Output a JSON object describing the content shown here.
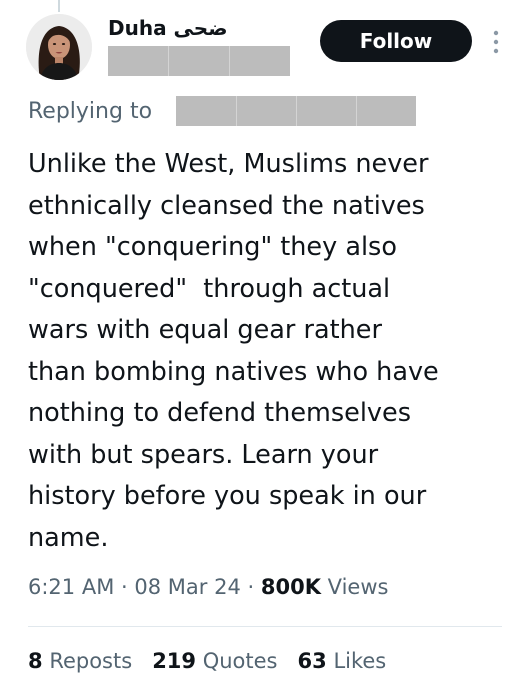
{
  "author": {
    "display_name": "Duha ضحى",
    "handle": "",
    "follow_label": "Follow"
  },
  "reply": {
    "label": "Replying to",
    "target": ""
  },
  "tweet": {
    "lines": [
      "Unlike the West, Muslims never",
      "ethnically cleansed the natives",
      "when \"conquering\" they also",
      "\"conquered\"  through actual",
      "wars with equal gear rather",
      "than bombing natives who have",
      "nothing to defend themselves",
      "with but spears. Learn your",
      "history before you speak in our",
      "name."
    ]
  },
  "meta": {
    "time": "6:21 AM",
    "separator": "·",
    "date": "08 Mar 24",
    "views_count": "800K",
    "views_label": "Views"
  },
  "stats": {
    "reposts_count": "8",
    "reposts_label": "Reposts",
    "quotes_count": "219",
    "quotes_label": "Quotes",
    "likes_count": "63",
    "likes_label": "Likes"
  },
  "icons": {
    "more": "more-vertical-icon",
    "avatar": "profile-photo"
  },
  "colors": {
    "text": "#0f1419",
    "secondary": "#536471",
    "follow_bg": "#0f1419",
    "redaction": "#bcbcbc"
  }
}
